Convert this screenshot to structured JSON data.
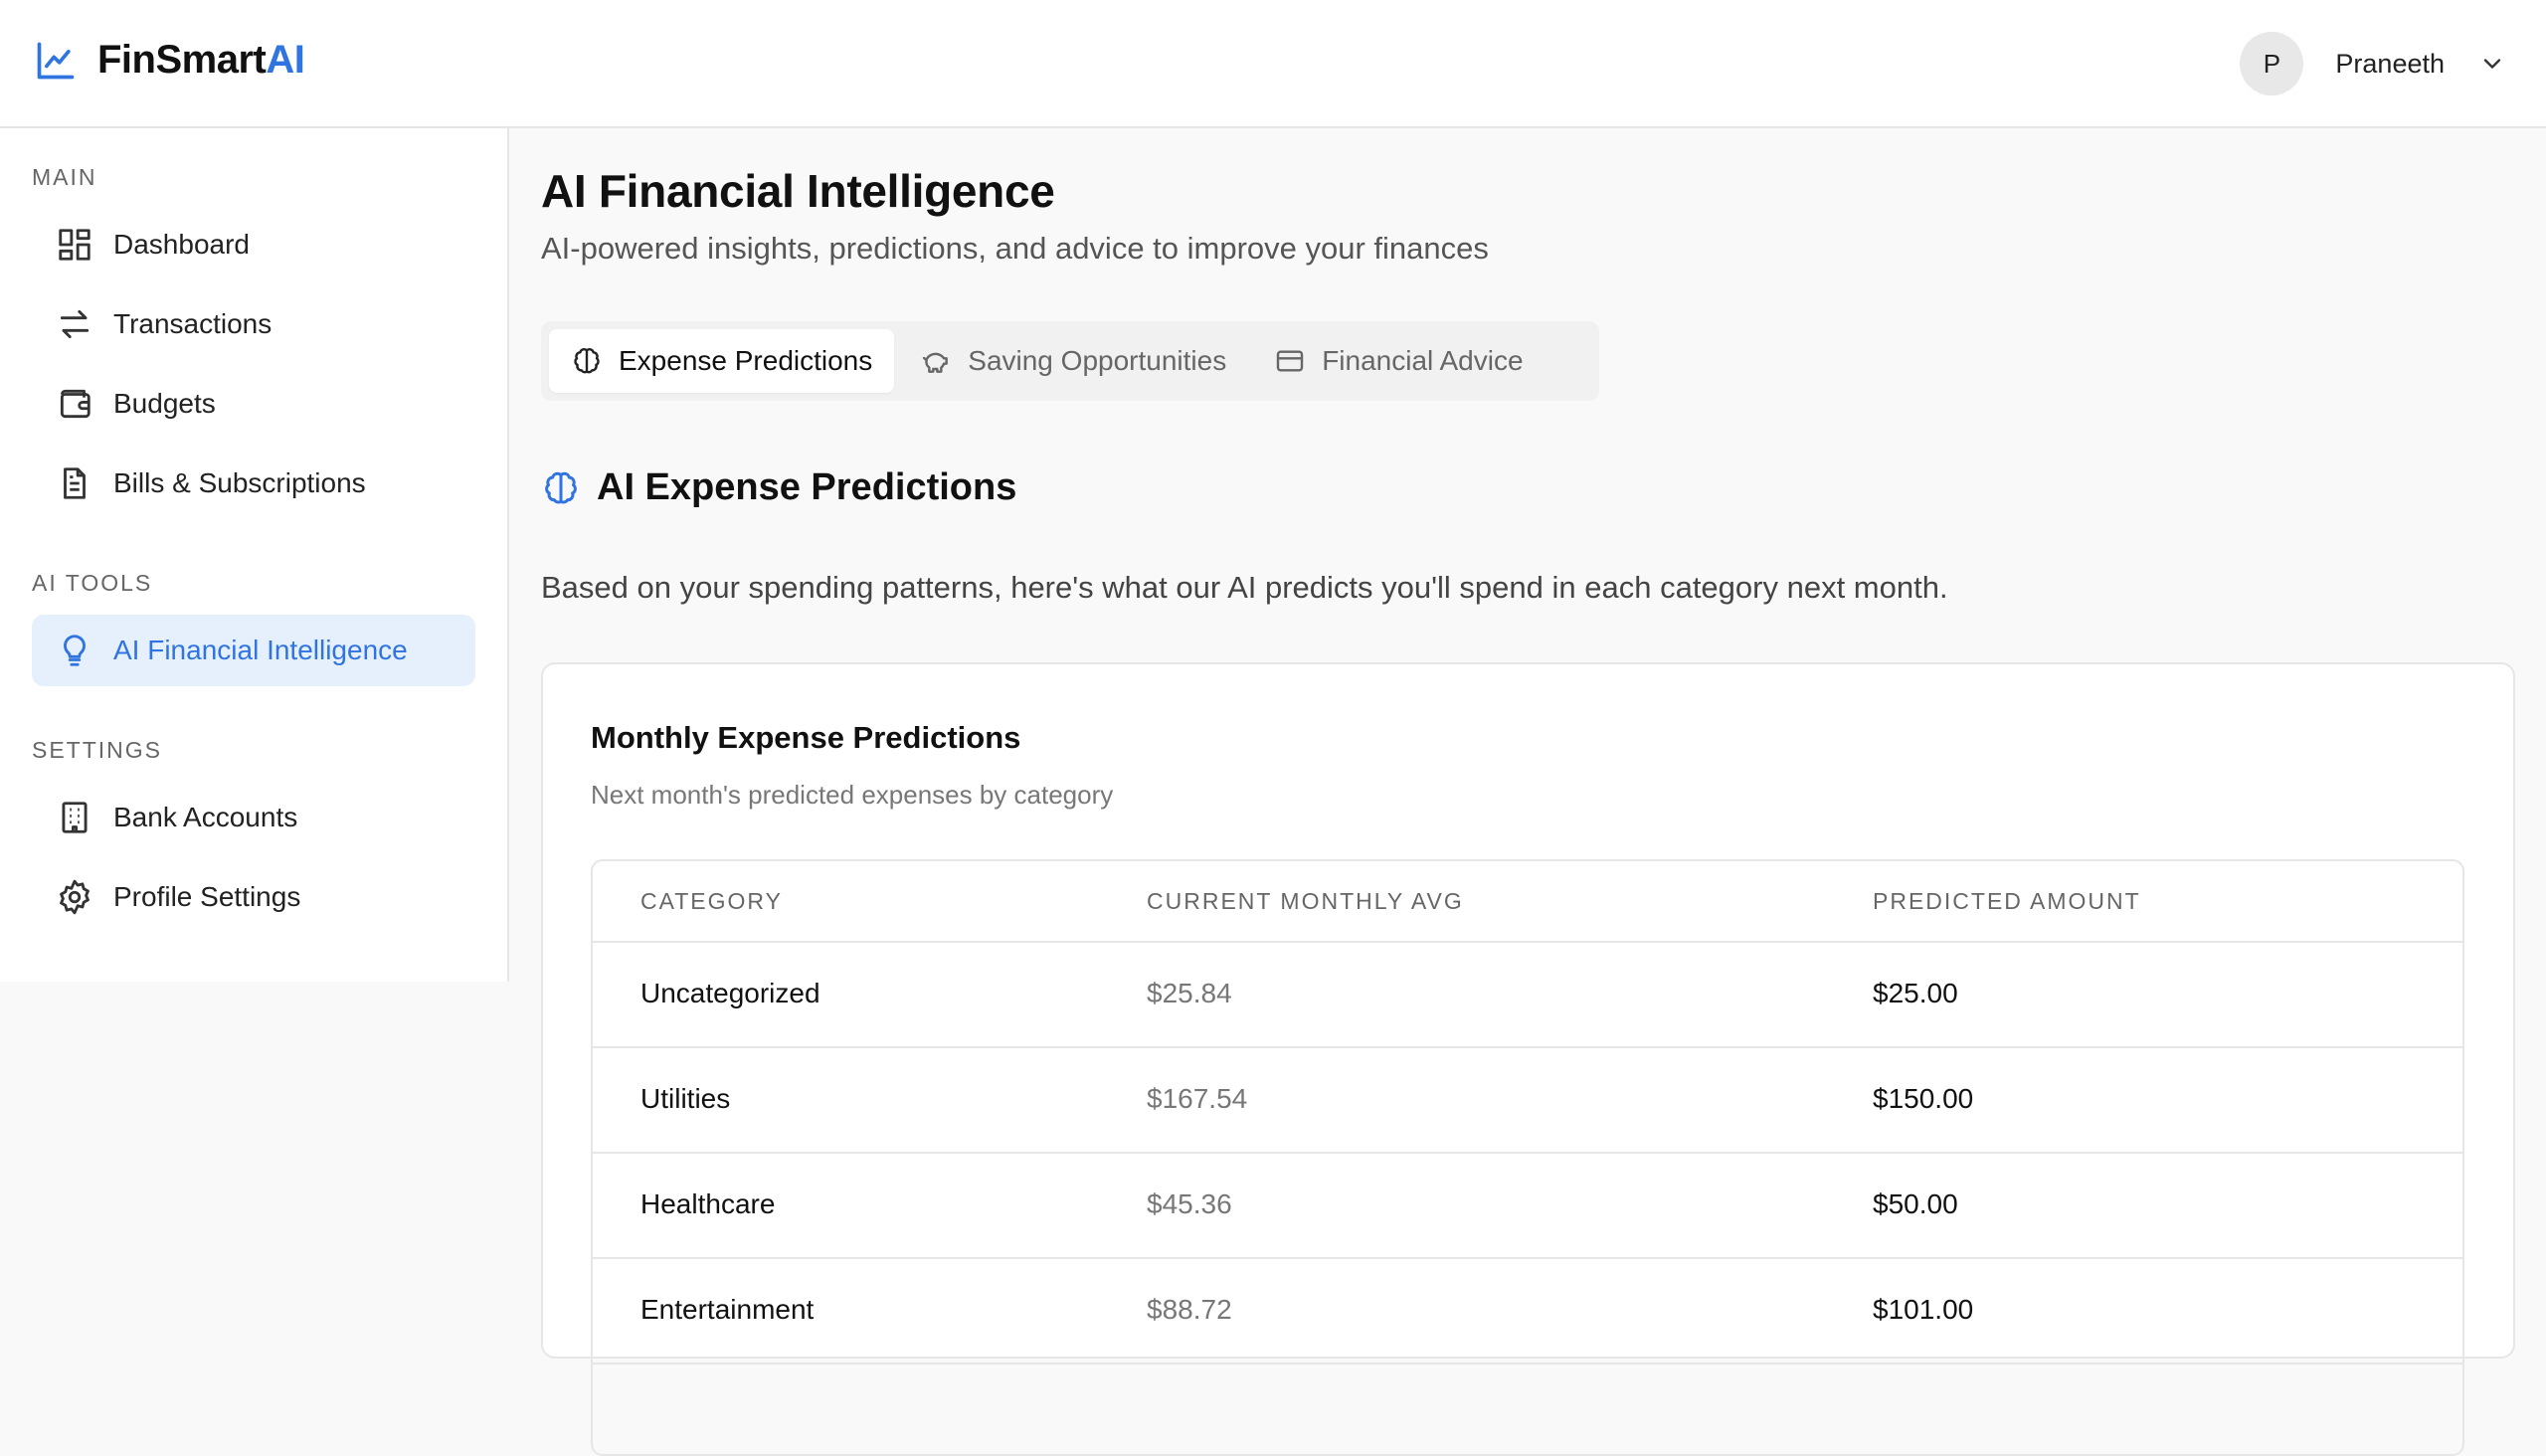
{
  "brand": {
    "name": "FinSmart",
    "accent": "AI"
  },
  "user": {
    "initial": "P",
    "name": "Praneeth"
  },
  "sidebar": {
    "sections": [
      {
        "label": "MAIN",
        "items": [
          {
            "label": "Dashboard",
            "icon": "dashboard-icon"
          },
          {
            "label": "Transactions",
            "icon": "transfer-icon"
          },
          {
            "label": "Budgets",
            "icon": "wallet-icon"
          },
          {
            "label": "Bills & Subscriptions",
            "icon": "document-icon"
          }
        ]
      },
      {
        "label": "AI TOOLS",
        "items": [
          {
            "label": "AI Financial Intelligence",
            "icon": "lightbulb-icon",
            "active": true
          }
        ]
      },
      {
        "label": "SETTINGS",
        "items": [
          {
            "label": "Bank Accounts",
            "icon": "building-icon"
          },
          {
            "label": "Profile Settings",
            "icon": "gear-icon"
          }
        ]
      }
    ]
  },
  "page": {
    "title": "AI Financial Intelligence",
    "subtitle": "AI-powered insights, predictions, and advice to improve your finances"
  },
  "tabs": [
    {
      "label": "Expense Predictions",
      "icon": "brain-icon",
      "active": true
    },
    {
      "label": "Saving Opportunities",
      "icon": "piggy-bank-icon"
    },
    {
      "label": "Financial Advice",
      "icon": "credit-card-icon"
    }
  ],
  "section": {
    "title": "AI Expense Predictions",
    "intro": "Based on your spending patterns, here's what our AI predicts you'll spend in each category next month."
  },
  "card": {
    "title": "Monthly Expense Predictions",
    "subtitle": "Next month's predicted expenses by category"
  },
  "table": {
    "headers": [
      "CATEGORY",
      "CURRENT MONTHLY AVG",
      "PREDICTED AMOUNT"
    ],
    "rows": [
      [
        "Uncategorized",
        "$25.84",
        "$25.00"
      ],
      [
        "Utilities",
        "$167.54",
        "$150.00"
      ],
      [
        "Healthcare",
        "$45.36",
        "$50.00"
      ],
      [
        "Entertainment",
        "$88.72",
        "$101.00"
      ]
    ]
  },
  "colors": {
    "accent": "#2f74e0",
    "active_bg": "#e6f0fc",
    "page_bg": "#f9f9f9"
  }
}
